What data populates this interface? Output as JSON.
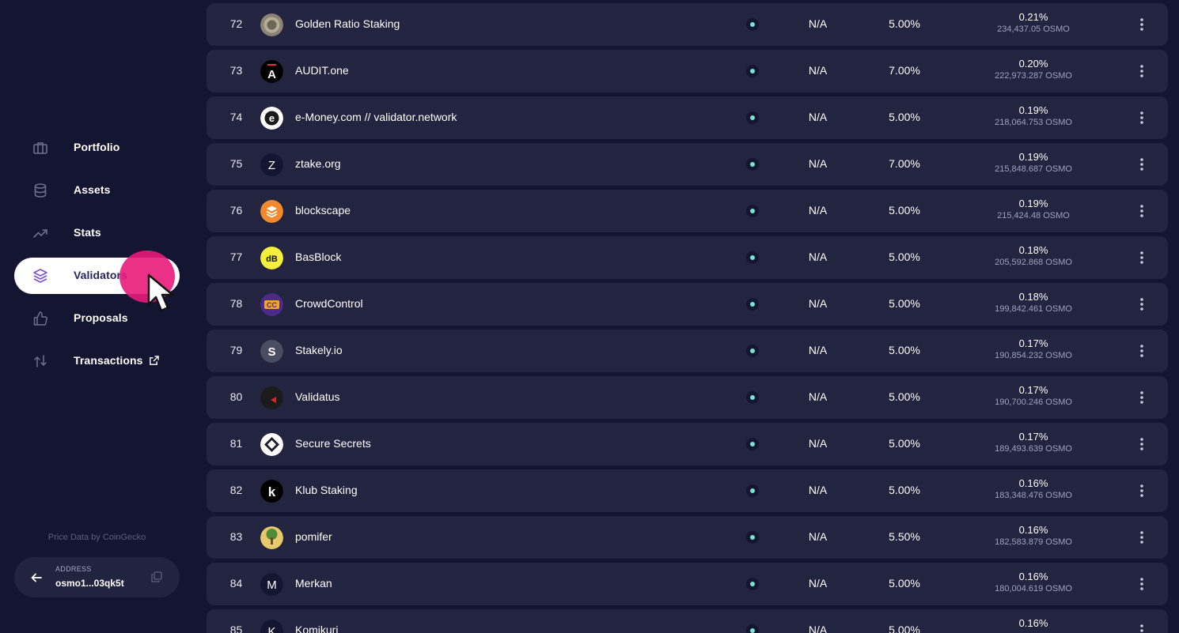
{
  "colors": {
    "background": "#141530",
    "row_background": "#23243f",
    "active_nav": "#ffffff",
    "accent_purple": "#7d4fd6",
    "status_dot": "#7be0d2",
    "cursor_halo": "#e8197a"
  },
  "sidebar": {
    "items": [
      {
        "label": "Portfolio",
        "icon": "briefcase-icon",
        "active": false
      },
      {
        "label": "Assets",
        "icon": "database-icon",
        "active": false
      },
      {
        "label": "Stats",
        "icon": "trending-up-icon",
        "active": false
      },
      {
        "label": "Validators",
        "icon": "layers-icon",
        "active": true
      },
      {
        "label": "Proposals",
        "icon": "thumbs-up-icon",
        "active": false
      },
      {
        "label": "Transactions",
        "icon": "transfer-arrows-icon",
        "active": false,
        "external": true
      }
    ],
    "price_note": "Price Data by CoinGecko",
    "address": {
      "label": "ADDRESS",
      "value": "osmo1...03qk5t"
    }
  },
  "validators": [
    {
      "rank": "72",
      "name": "Golden Ratio Staking",
      "uptime": "N/A",
      "commission": "5.00%",
      "voting_power": "0.21%",
      "amount": "234,437.05 OSMO",
      "logo": "golden-coin"
    },
    {
      "rank": "73",
      "name": "AUDIT.one",
      "uptime": "N/A",
      "commission": "7.00%",
      "voting_power": "0.20%",
      "amount": "222,973.287 OSMO",
      "logo": "letter-a-black"
    },
    {
      "rank": "74",
      "name": "e-Money.com // validator.network",
      "uptime": "N/A",
      "commission": "5.00%",
      "voting_power": "0.19%",
      "amount": "218,064.753 OSMO",
      "logo": "letter-e-white"
    },
    {
      "rank": "75",
      "name": "ztake.org",
      "uptime": "N/A",
      "commission": "7.00%",
      "voting_power": "0.19%",
      "amount": "215,848.687 OSMO",
      "logo": "letter-z-dark"
    },
    {
      "rank": "76",
      "name": "blockscape",
      "uptime": "N/A",
      "commission": "5.00%",
      "voting_power": "0.19%",
      "amount": "215,424.48 OSMO",
      "logo": "orange-stack"
    },
    {
      "rank": "77",
      "name": "BasBlock",
      "uptime": "N/A",
      "commission": "5.00%",
      "voting_power": "0.18%",
      "amount": "205,592.868 OSMO",
      "logo": "yellow-bb"
    },
    {
      "rank": "78",
      "name": "CrowdControl",
      "uptime": "N/A",
      "commission": "5.00%",
      "voting_power": "0.18%",
      "amount": "199,842.461 OSMO",
      "logo": "purple-cc"
    },
    {
      "rank": "79",
      "name": "Stakely.io",
      "uptime": "N/A",
      "commission": "5.00%",
      "voting_power": "0.17%",
      "amount": "190,854.232 OSMO",
      "logo": "grey-s"
    },
    {
      "rank": "80",
      "name": "Validatus",
      "uptime": "N/A",
      "commission": "5.00%",
      "voting_power": "0.17%",
      "amount": "190,700.246 OSMO",
      "logo": "black-red"
    },
    {
      "rank": "81",
      "name": "Secure Secrets",
      "uptime": "N/A",
      "commission": "5.00%",
      "voting_power": "0.17%",
      "amount": "189,493.639 OSMO",
      "logo": "white-diamond"
    },
    {
      "rank": "82",
      "name": "Klub Staking",
      "uptime": "N/A",
      "commission": "5.00%",
      "voting_power": "0.16%",
      "amount": "183,348.476 OSMO",
      "logo": "black-k"
    },
    {
      "rank": "83",
      "name": "pomifer",
      "uptime": "N/A",
      "commission": "5.50%",
      "voting_power": "0.16%",
      "amount": "182,583.879 OSMO",
      "logo": "bonsai-tree"
    },
    {
      "rank": "84",
      "name": "Merkan",
      "uptime": "N/A",
      "commission": "5.00%",
      "voting_power": "0.16%",
      "amount": "180,004.619 OSMO",
      "logo": "letter-m-dark"
    },
    {
      "rank": "85",
      "name": "Komikuri",
      "uptime": "N/A",
      "commission": "5.00%",
      "voting_power": "0.16%",
      "amount": "",
      "logo": "letter-k-dark"
    }
  ]
}
